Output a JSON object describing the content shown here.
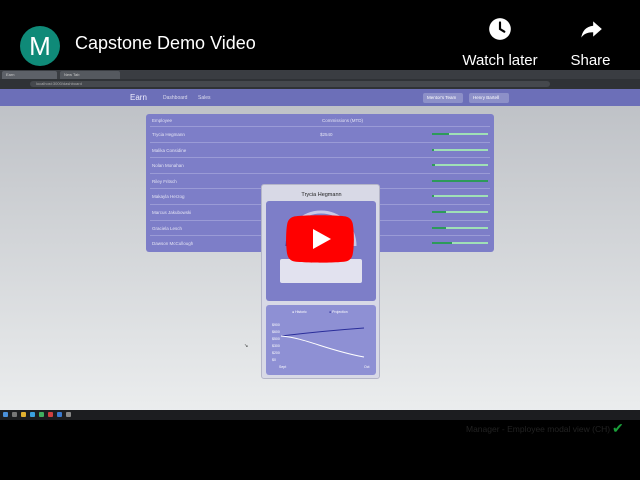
{
  "video": {
    "title": "Capstone Demo Video",
    "channel_initial": "M",
    "watch_later_label": "Watch later",
    "share_label": "Share"
  },
  "browser": {
    "tabs": [
      "Earn",
      "New Tab"
    ],
    "address": "localhost:3000/dashboard"
  },
  "app": {
    "logo": "Earn",
    "nav": [
      "Dashboard",
      "Sales"
    ],
    "buttons": [
      "Mentor's Team",
      "Henry Bartell"
    ]
  },
  "table": {
    "headers": [
      "Employee",
      "Commissions (MTD)"
    ],
    "rows": [
      {
        "name": "Trycia Hegmann",
        "value": "$2540",
        "progress": 0.31
      },
      {
        "name": "Malika Considine",
        "value": "",
        "progress": 0.0
      },
      {
        "name": "Nolan Monahan",
        "value": "",
        "progress": 0.05
      },
      {
        "name": "Riley Fritsch",
        "value": "",
        "progress": 1.0
      },
      {
        "name": "Makayla Herzog",
        "value": "",
        "progress": 0.04
      },
      {
        "name": "Marcus Jakubowski",
        "value": "",
        "progress": 0.25
      },
      {
        "name": "Graciela Lesch",
        "value": "",
        "progress": 0.25
      },
      {
        "name": "Dawson McCullough",
        "value": "",
        "progress": 0.35
      }
    ]
  },
  "modal": {
    "employee_name": "Trycia Hegmann",
    "gauge_percent": "31%",
    "gauge_value": 0.31,
    "legend": [
      "Historic",
      "Projection"
    ],
    "y_ticks": [
      "$900",
      "$600",
      "$500",
      "$300",
      "$200",
      "$0"
    ],
    "x_ticks": [
      "Sept",
      "Oct"
    ]
  },
  "caption": "Manager - Employee modal view (CH)",
  "colors": {
    "app_bar": "#6c6fb8",
    "card": "#7d7ec8",
    "progress_fill": "#2d9a5a",
    "yt_red": "#ff0000",
    "check": "#1aa03a"
  }
}
